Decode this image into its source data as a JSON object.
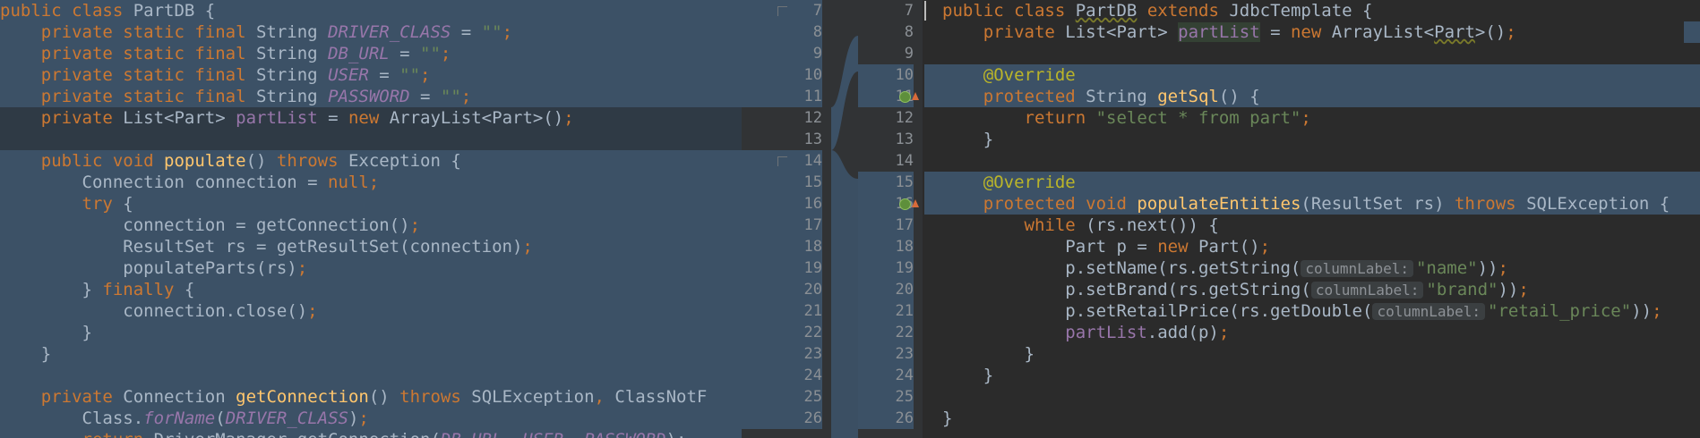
{
  "left": {
    "lines": [
      {
        "segs": [
          [
            "kw",
            "public class "
          ],
          [
            "plain",
            "PartDB {"
          ]
        ]
      },
      {
        "segs": [
          [
            "plain",
            "    "
          ],
          [
            "kw",
            "private static final "
          ],
          [
            "plain",
            "String "
          ],
          [
            "fld",
            "DRIVER_CLASS"
          ],
          [
            "plain",
            " = "
          ],
          [
            "str",
            "\"\""
          ],
          [
            "kw",
            ";"
          ]
        ]
      },
      {
        "segs": [
          [
            "plain",
            "    "
          ],
          [
            "kw",
            "private static final "
          ],
          [
            "plain",
            "String "
          ],
          [
            "fld",
            "DB_URL"
          ],
          [
            "plain",
            " = "
          ],
          [
            "str",
            "\"\""
          ],
          [
            "kw",
            ";"
          ]
        ]
      },
      {
        "segs": [
          [
            "plain",
            "    "
          ],
          [
            "kw",
            "private static final "
          ],
          [
            "plain",
            "String "
          ],
          [
            "fld",
            "USER"
          ],
          [
            "plain",
            " = "
          ],
          [
            "str",
            "\"\""
          ],
          [
            "kw",
            ";"
          ]
        ]
      },
      {
        "segs": [
          [
            "plain",
            "    "
          ],
          [
            "kw",
            "private static final "
          ],
          [
            "plain",
            "String "
          ],
          [
            "fld",
            "PASSWORD"
          ],
          [
            "plain",
            " = "
          ],
          [
            "str",
            "\"\""
          ],
          [
            "kw",
            ";"
          ]
        ]
      },
      {
        "segs": [
          [
            "plain",
            "    "
          ],
          [
            "kw",
            "private "
          ],
          [
            "plain",
            "List<Part> "
          ],
          [
            "fld2",
            "partList"
          ],
          [
            "plain",
            " = "
          ],
          [
            "kw",
            "new "
          ],
          [
            "plain",
            "ArrayList<Part>()"
          ],
          [
            "kw",
            ";"
          ]
        ]
      },
      {
        "segs": []
      },
      {
        "segs": [
          [
            "plain",
            "    "
          ],
          [
            "kw",
            "public void "
          ],
          [
            "fn",
            "populate"
          ],
          [
            "plain",
            "() "
          ],
          [
            "kw",
            "throws "
          ],
          [
            "plain",
            "Exception {"
          ]
        ]
      },
      {
        "segs": [
          [
            "plain",
            "        Connection connection = "
          ],
          [
            "kw",
            "null;"
          ]
        ]
      },
      {
        "segs": [
          [
            "plain",
            "        "
          ],
          [
            "kw",
            "try "
          ],
          [
            "plain",
            "{"
          ]
        ]
      },
      {
        "segs": [
          [
            "plain",
            "            connection = getConnection()"
          ],
          [
            "kw",
            ";"
          ]
        ]
      },
      {
        "segs": [
          [
            "plain",
            "            ResultSet rs = getResultSet(connection)"
          ],
          [
            "kw",
            ";"
          ]
        ]
      },
      {
        "segs": [
          [
            "plain",
            "            populateParts(rs)"
          ],
          [
            "kw",
            ";"
          ]
        ]
      },
      {
        "segs": [
          [
            "plain",
            "        } "
          ],
          [
            "kw",
            "finally "
          ],
          [
            "plain",
            "{"
          ]
        ]
      },
      {
        "segs": [
          [
            "plain",
            "            connection.close()"
          ],
          [
            "kw",
            ";"
          ]
        ]
      },
      {
        "segs": [
          [
            "plain",
            "        }"
          ]
        ]
      },
      {
        "segs": [
          [
            "plain",
            "    }"
          ]
        ]
      },
      {
        "segs": []
      },
      {
        "segs": [
          [
            "plain",
            "    "
          ],
          [
            "kw",
            "private "
          ],
          [
            "plain",
            "Connection "
          ],
          [
            "fn",
            "getConnection"
          ],
          [
            "plain",
            "() "
          ],
          [
            "kw",
            "throws "
          ],
          [
            "plain",
            "SQLException"
          ],
          [
            "kw",
            ", "
          ],
          [
            "plain",
            "ClassNotF"
          ]
        ]
      },
      {
        "segs": [
          [
            "plain",
            "        Class."
          ],
          [
            "fld",
            "forName"
          ],
          [
            "plain",
            "("
          ],
          [
            "fld",
            "DRIVER_CLASS"
          ],
          [
            "plain",
            ")"
          ],
          [
            "kw",
            ";"
          ]
        ]
      },
      {
        "segs": [
          [
            "plain",
            "        "
          ],
          [
            "kw",
            "return "
          ],
          [
            "plain",
            "DriverManager.getConnection("
          ],
          [
            "fld",
            "DB_URL"
          ],
          [
            "kw",
            ", "
          ],
          [
            "fld",
            "USER"
          ],
          [
            "kw",
            ", "
          ],
          [
            "fld",
            "PASSWORD"
          ],
          [
            "plain",
            ");"
          ]
        ]
      }
    ]
  },
  "gutter_left": {
    "numbers": [
      "7",
      "8",
      "9",
      "10",
      "11",
      "12",
      "13",
      "14",
      "15",
      "16",
      "17",
      "18",
      "19",
      "20",
      "21",
      "22",
      "23",
      "24",
      "25",
      "26"
    ]
  },
  "gutter_right": {
    "numbers": [
      "7",
      "8",
      "9",
      "10",
      "11",
      "12",
      "13",
      "14",
      "15",
      "16",
      "17",
      "18",
      "19",
      "20",
      "21",
      "22",
      "23",
      "24",
      "25",
      "26"
    ]
  },
  "right": {
    "lines": [
      {
        "segs": [
          [
            "kw",
            "public class "
          ],
          [
            "wavy",
            "PartDB"
          ],
          [
            "plain",
            " "
          ],
          [
            "kw",
            "extends "
          ],
          [
            "plain",
            "JdbcTemplate {"
          ]
        ]
      },
      {
        "segs": [
          [
            "plain",
            "    "
          ],
          [
            "kw",
            "private "
          ],
          [
            "plain",
            "List<Part> "
          ],
          [
            "usage",
            "partList"
          ],
          [
            "plain",
            " = "
          ],
          [
            "kw",
            "new "
          ],
          [
            "plain",
            "ArrayList<"
          ],
          [
            "wavy",
            "Part"
          ],
          [
            "plain",
            ">()"
          ],
          [
            "kw",
            ";"
          ]
        ]
      },
      {
        "segs": []
      },
      {
        "segs": [
          [
            "plain",
            "    "
          ],
          [
            "ann",
            "@Override"
          ]
        ]
      },
      {
        "segs": [
          [
            "plain",
            "    "
          ],
          [
            "kw",
            "protected "
          ],
          [
            "plain",
            "String "
          ],
          [
            "fn",
            "getSql"
          ],
          [
            "plain",
            "() {"
          ]
        ]
      },
      {
        "segs": [
          [
            "plain",
            "        "
          ],
          [
            "kw",
            "return "
          ],
          [
            "str",
            "\"select * from part\""
          ],
          [
            "kw",
            ";"
          ]
        ]
      },
      {
        "segs": [
          [
            "plain",
            "    }"
          ]
        ]
      },
      {
        "segs": []
      },
      {
        "segs": [
          [
            "plain",
            "    "
          ],
          [
            "ann",
            "@Override"
          ]
        ]
      },
      {
        "segs": [
          [
            "plain",
            "    "
          ],
          [
            "kw",
            "protected void "
          ],
          [
            "fn",
            "populateEntities"
          ],
          [
            "plain",
            "(ResultSet rs) "
          ],
          [
            "kw",
            "throws "
          ],
          [
            "plain",
            "SQLException {"
          ]
        ]
      },
      {
        "segs": [
          [
            "plain",
            "        "
          ],
          [
            "kw",
            "while "
          ],
          [
            "plain",
            "(rs.next()) {"
          ]
        ]
      },
      {
        "segs": [
          [
            "plain",
            "            Part p = "
          ],
          [
            "kw",
            "new "
          ],
          [
            "plain",
            "Part()"
          ],
          [
            "kw",
            ";"
          ]
        ]
      },
      {
        "segs": [
          [
            "plain",
            "            p.setName(rs.getString("
          ],
          [
            "hint",
            "columnLabel:"
          ],
          [
            "str",
            "\"name\""
          ],
          [
            "plain",
            "))"
          ],
          [
            "kw",
            ";"
          ]
        ]
      },
      {
        "segs": [
          [
            "plain",
            "            p.setBrand(rs.getString("
          ],
          [
            "hint",
            "columnLabel:"
          ],
          [
            "str",
            "\"brand\""
          ],
          [
            "plain",
            "))"
          ],
          [
            "kw",
            ";"
          ]
        ]
      },
      {
        "segs": [
          [
            "plain",
            "            p.setRetailPrice(rs.getDouble("
          ],
          [
            "hint",
            "columnLabel:"
          ],
          [
            "str",
            "\"retail_price\""
          ],
          [
            "plain",
            "))"
          ],
          [
            "kw",
            ";"
          ]
        ]
      },
      {
        "segs": [
          [
            "plain",
            "            "
          ],
          [
            "fld2",
            "partList"
          ],
          [
            "plain",
            ".add(p)"
          ],
          [
            "kw",
            ";"
          ]
        ]
      },
      {
        "segs": [
          [
            "plain",
            "        }"
          ]
        ]
      },
      {
        "segs": [
          [
            "plain",
            "    }"
          ]
        ]
      },
      {
        "segs": []
      },
      {
        "segs": [
          [
            "plain",
            "}"
          ]
        ]
      }
    ]
  },
  "colors": {
    "background": "#2b2b2b",
    "gutter": "#313335",
    "diff_highlight": "#3c5166",
    "keyword": "#cc7832",
    "string": "#6a8759",
    "field": "#9876aa",
    "method": "#ffc66d",
    "annotation": "#bbb529"
  },
  "icons": {
    "fold": "fold-marker-icon",
    "implements": "override-method-icon",
    "override_arrow": "arrow-up-icon"
  }
}
